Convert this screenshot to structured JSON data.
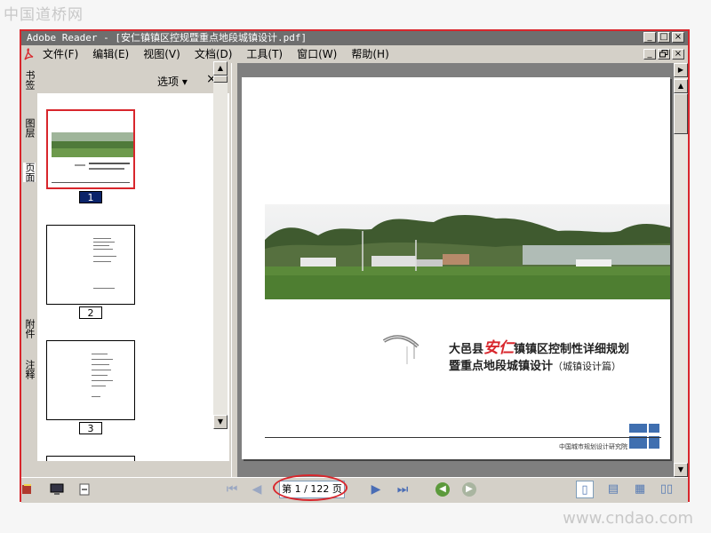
{
  "watermark_top": "中国道桥网",
  "watermark_bottom": "www.cndao.com",
  "window": {
    "title": "Adobe Reader - [安仁镇镇区控规暨重点地段城镇设计.pdf]",
    "buttons": {
      "minimize": "_",
      "maximize": "□",
      "close": "×",
      "restore": "🗗"
    }
  },
  "menubar": {
    "items": [
      {
        "label": "文件(F)"
      },
      {
        "label": "编辑(E)"
      },
      {
        "label": "视图(V)"
      },
      {
        "label": "文档(D)"
      },
      {
        "label": "工具(T)"
      },
      {
        "label": "窗口(W)"
      },
      {
        "label": "帮助(H)"
      }
    ]
  },
  "side_tabs": [
    {
      "label": "书签"
    },
    {
      "label": "图层"
    },
    {
      "label": "页面"
    },
    {
      "label": "附件"
    },
    {
      "label": "注释"
    }
  ],
  "pages_panel": {
    "options_label": "选项 ▾",
    "close_label": "×",
    "thumbnails": [
      {
        "number": "1",
        "selected": true
      },
      {
        "number": "2",
        "selected": false
      },
      {
        "number": "3",
        "selected": false
      }
    ]
  },
  "document": {
    "title_prefix": "大邑县",
    "title_highlight": "安仁",
    "title_suffix": "镇镇区控制性详细规划",
    "subtitle_main": "暨重点地段城镇设计",
    "subtitle_note": "（城镇设计篇）",
    "organization": "中国城市规划设计研究院"
  },
  "status": {
    "page_indicator": "第 1 / 122 页"
  },
  "colors": {
    "accent_red": "#d8262c",
    "chrome_gray": "#d4d0c8",
    "title_bar": "#6e6e6e",
    "nav_green": "#5c9a3c"
  }
}
